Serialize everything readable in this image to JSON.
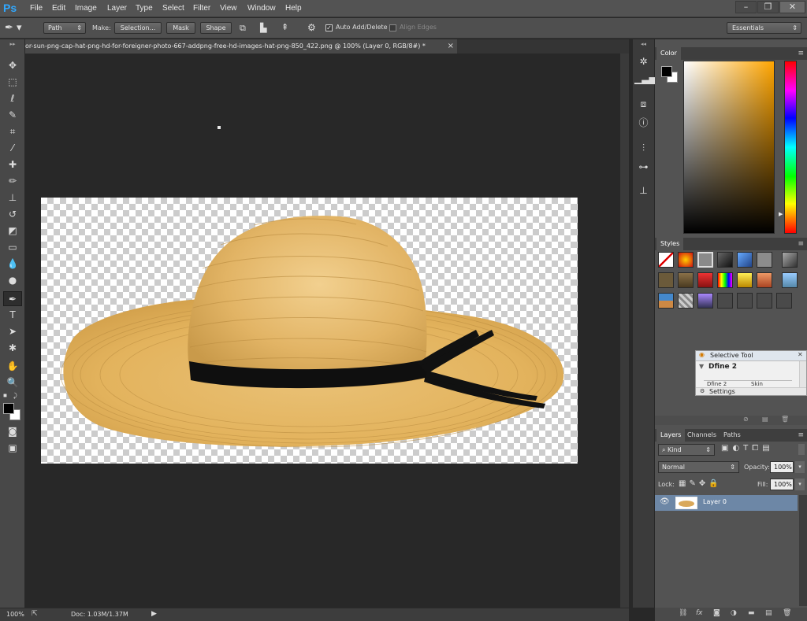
{
  "menubar": {
    "logo": "Ps",
    "items": [
      "File",
      "Edit",
      "Image",
      "Layer",
      "Type",
      "Select",
      "Filter",
      "View",
      "Window",
      "Help"
    ],
    "window_buttons": [
      "–",
      "❐",
      "✕"
    ]
  },
  "options": {
    "mode_value": "Path",
    "make_label": "Make:",
    "selection_label": "Selection...",
    "mask_label": "Mask",
    "shape_label": "Shape",
    "auto_add_delete_label": "Auto Add/Delete",
    "align_edges_label": "Align Edges",
    "workspace_value": "Essentials"
  },
  "document": {
    "tab_title": "or-sun-png-cap-hat-png-hd-for-foreigner-photo-667-addpng-free-hd-images-hat-png-850_422.png @ 100% (Layer 0, RGB/8#) *",
    "close_icon": "×"
  },
  "status": {
    "zoom": "100%",
    "doc_info": "Doc: 1.03M/1.37M"
  },
  "panels": {
    "color_tab": "Color",
    "styles_tab": "Styles",
    "layers_tabs": [
      "Layers",
      "Channels",
      "Paths"
    ]
  },
  "selective_tool": {
    "title": "Selective Tool",
    "section": "Dfine 2",
    "subtab_left": "Dfine 2",
    "subtab_right": "Skin",
    "settings": "Settings"
  },
  "layers": {
    "kind_value": "Kind",
    "blend_value": "Normal",
    "opacity_label": "Opacity:",
    "opacity_value": "100%",
    "lock_label": "Lock:",
    "fill_label": "Fill:",
    "fill_value": "100%",
    "items": [
      {
        "name": "Layer 0"
      }
    ]
  },
  "colors": {
    "foreground": "#000000",
    "background": "#ffffff",
    "picker_hue": "#ffa500"
  }
}
